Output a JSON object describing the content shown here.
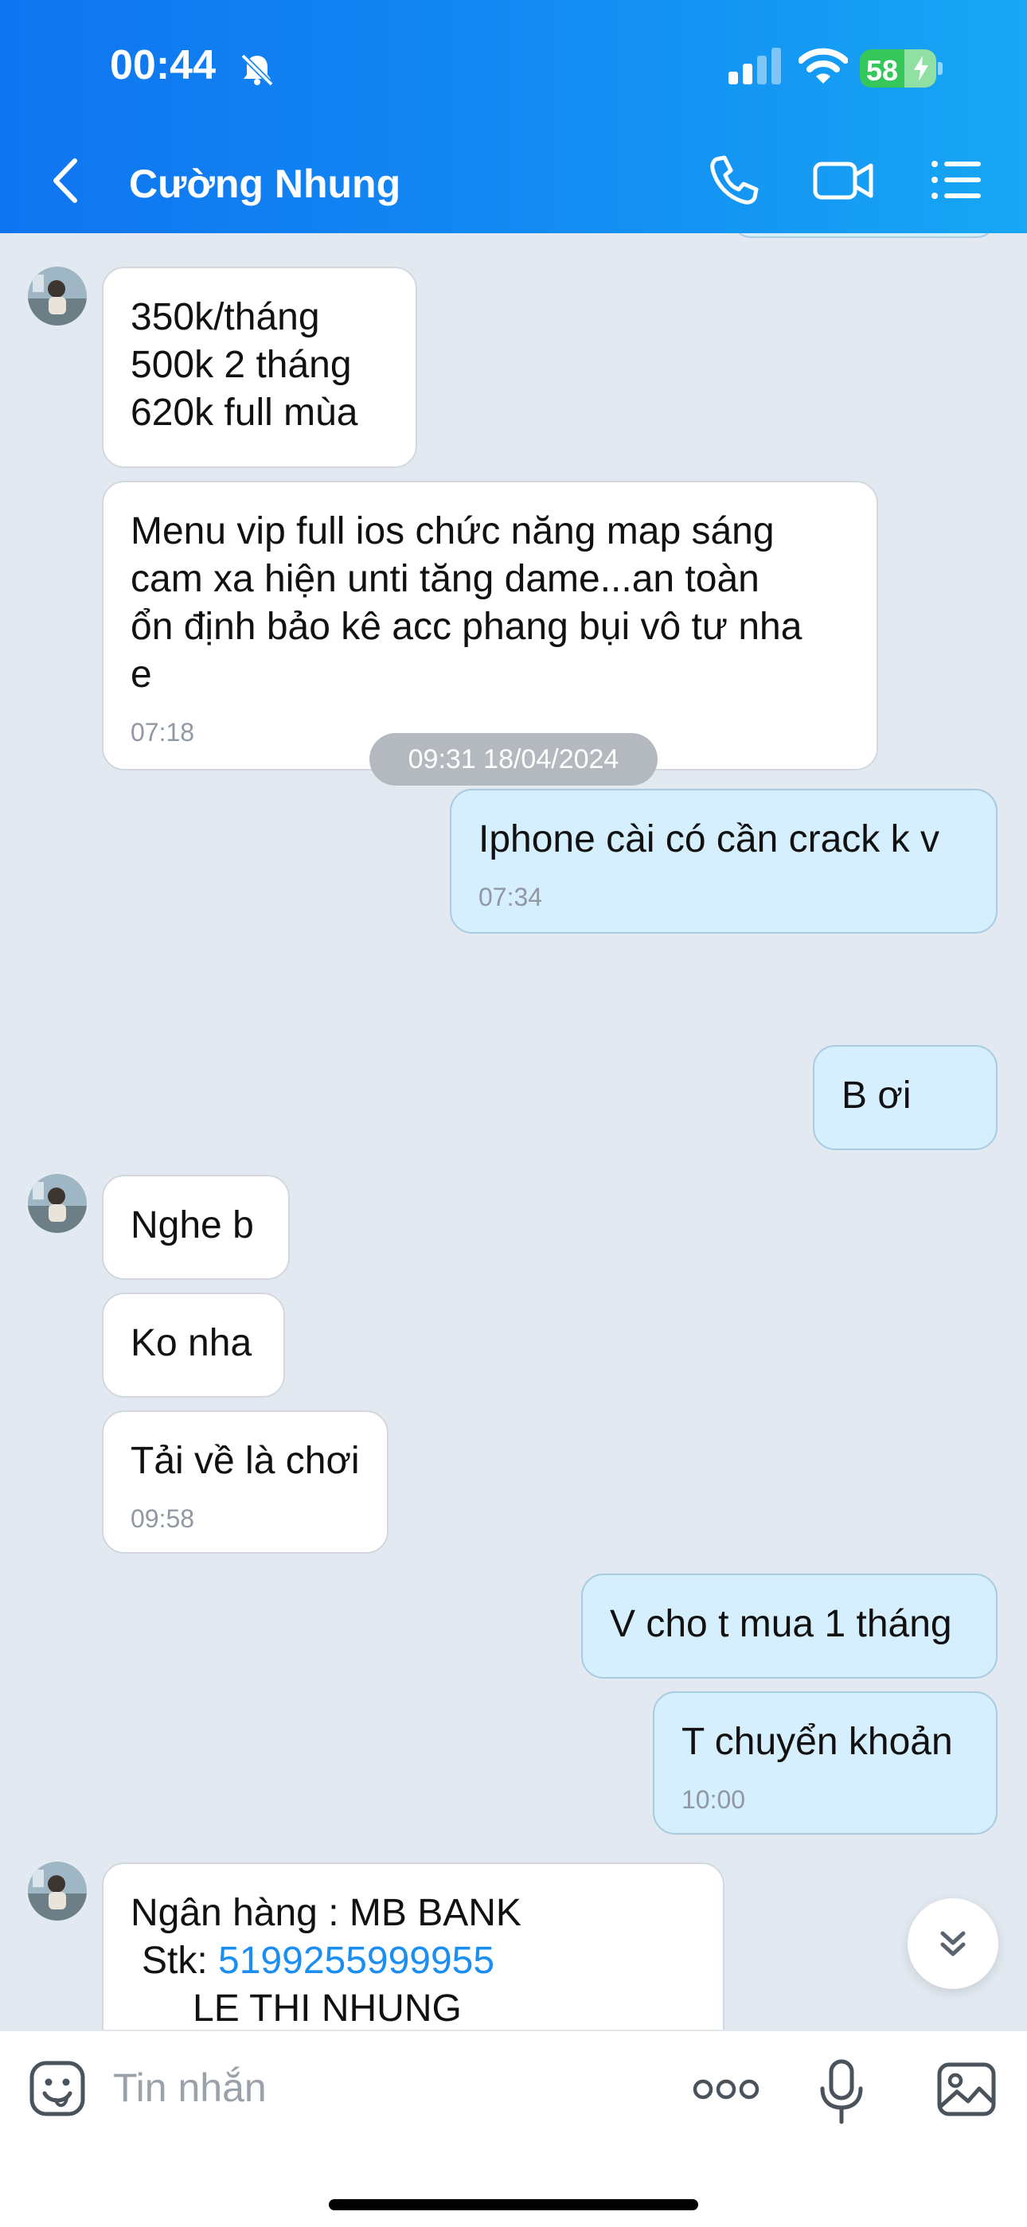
{
  "status_bar": {
    "time": "00:44",
    "battery": "58"
  },
  "header": {
    "contact_name": "Cường Nhung"
  },
  "messages": [
    {
      "text": "350k/tháng\n500k 2 tháng\n620k full mùa"
    },
    {
      "text": "Menu vip full ios chức năng map sáng\ncam xa hiện unti tăng dame...an toàn\nổn định bảo kê acc phang bụi vô tư nha\ne",
      "time": "07:18"
    },
    {
      "text": "Iphone cài có cần crack k v",
      "time": "07:34"
    },
    {
      "text": "B ơi"
    },
    {
      "text": "Nghe b"
    },
    {
      "text": "Ko nha"
    },
    {
      "text": "Tải về là chơi",
      "time": "09:58"
    },
    {
      "text": "V cho t mua 1 tháng"
    },
    {
      "text": "T chuyển khoản",
      "time": "10:00"
    }
  ],
  "date_separator": "09:31 18/04/2024",
  "bank_message": {
    "bank_line": "Ngân hàng : MB BANK",
    "account_label": "Stk: ",
    "account_number": "5199255999955",
    "account_name": "LE THI NHUNG"
  },
  "composer": {
    "placeholder": "Tin nhắn"
  }
}
